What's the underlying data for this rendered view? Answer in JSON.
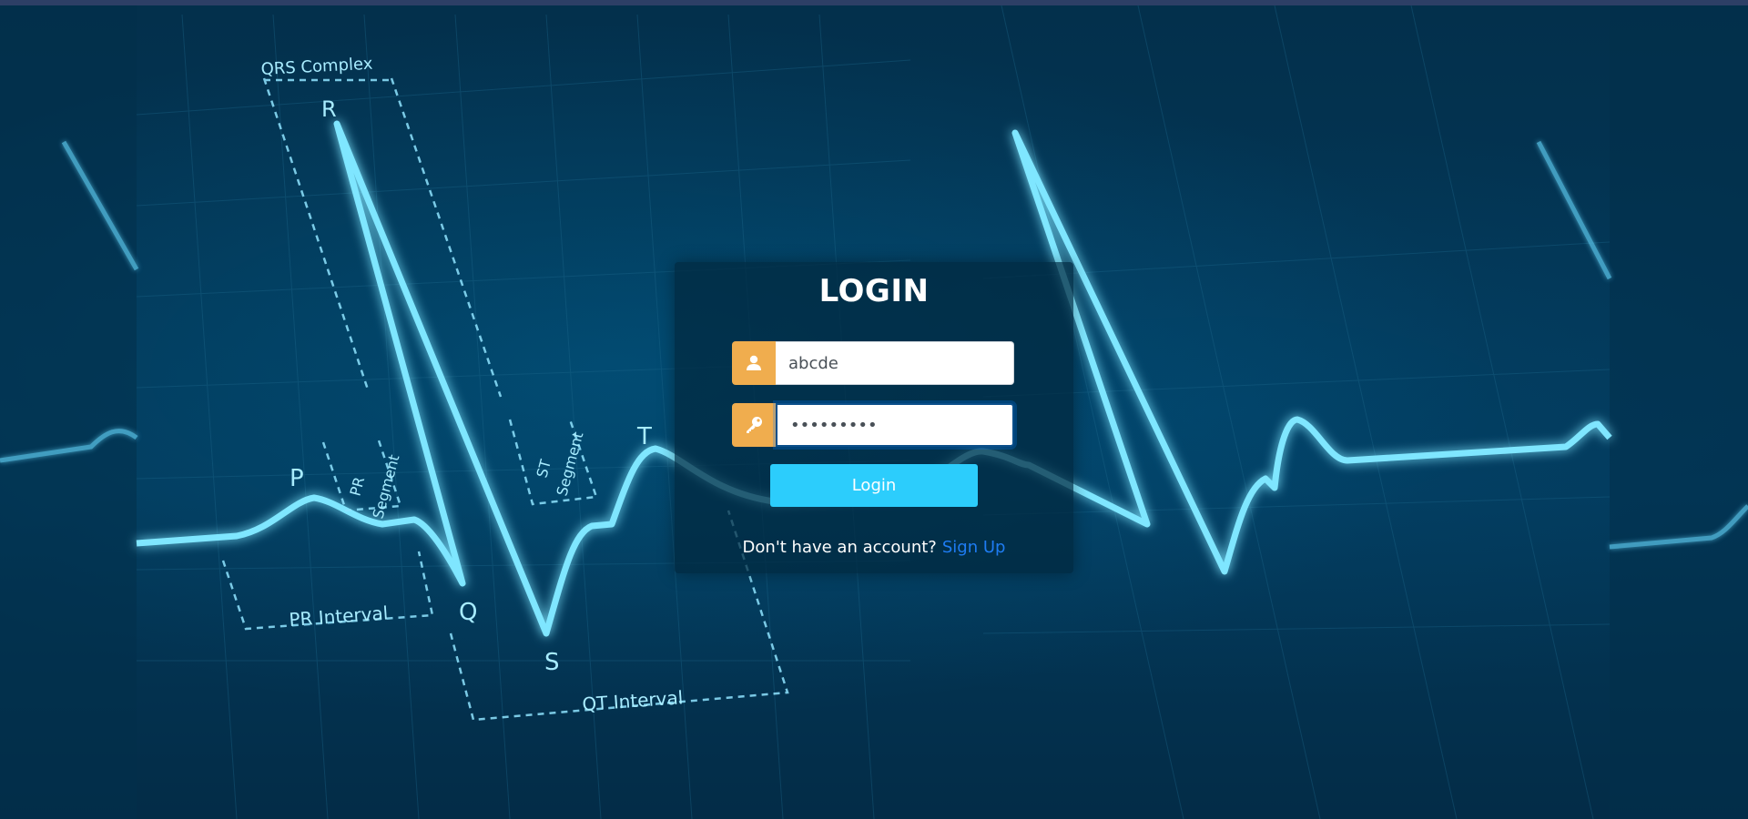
{
  "login": {
    "title": "LOGIN",
    "username_value": "abcde",
    "password_value": "secret123",
    "button_label": "Login",
    "signup_prompt": "Don't have an account?",
    "signup_link": "Sign Up"
  },
  "icons": {
    "username": "user-icon",
    "password": "key-icon"
  },
  "background": {
    "labels": {
      "qrs_complex": "QRS Complex",
      "r": "R",
      "p": "P",
      "q": "Q",
      "s": "S",
      "t": "T",
      "pr_segment_1": "PR",
      "pr_segment_2": "Segment",
      "st_segment_1": "ST",
      "st_segment_2": "Segment",
      "pr_interval": "PR Interval",
      "qt_interval": "QT Interval"
    }
  },
  "colors": {
    "background": "#032f4b",
    "accent_orange": "#f0ad4e",
    "button_cyan": "#2ccdfc",
    "link_blue": "#1e7cf2",
    "ecg_line": "#7fe6ff"
  }
}
